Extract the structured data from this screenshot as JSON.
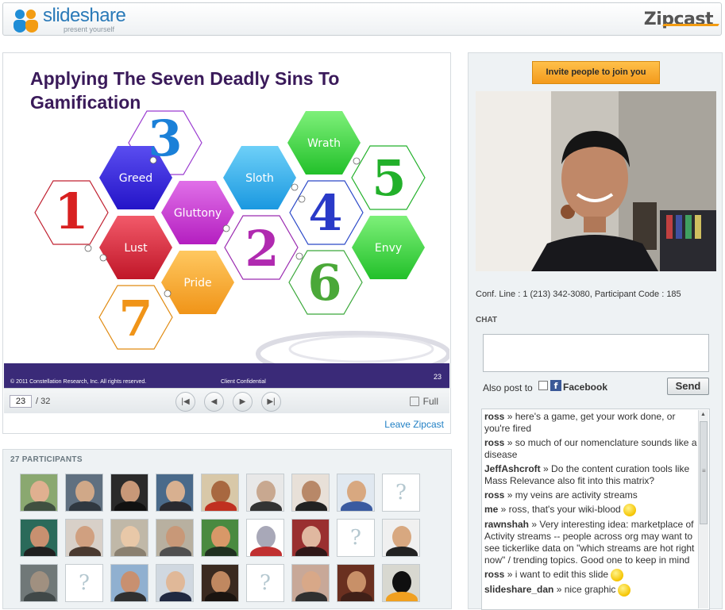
{
  "header": {
    "brand": "slideshare",
    "tagline": "present yourself",
    "product": "Zipcast"
  },
  "slide": {
    "title": "Applying The Seven Deadly Sins To Gamification",
    "sins": [
      "Greed",
      "Gluttony",
      "Sloth",
      "Wrath",
      "Lust",
      "Envy",
      "Pride"
    ],
    "numbers": [
      "1",
      "2",
      "3",
      "4",
      "5",
      "6",
      "7"
    ],
    "footer_left": "© 2011 Constellation Research, Inc.  All rights reserved.",
    "footer_mid": "Client Confidential",
    "footer_page": "23"
  },
  "controls": {
    "current_page": "23",
    "total": "/ 32",
    "full_label": "Full",
    "leave_label": "Leave Zipcast"
  },
  "participants": {
    "title": "27 PARTICIPANTS",
    "unknown_glyph": "?"
  },
  "right": {
    "invite_label": "Invite people to join you",
    "conf_line": "Conf. Line : 1 (213) 342-3080, Participant Code : 185",
    "chat_label": "CHAT",
    "also_post": "Also post to",
    "facebook": "Facebook",
    "send": "Send"
  },
  "chat": [
    {
      "user": "ross",
      "text": " » here's a game, get your work done, or you're fired"
    },
    {
      "user": "ross",
      "text": " » so much of our nomenclature sounds like a disease"
    },
    {
      "user": "JeffAshcroft",
      "text": " » Do the content curation tools like Mass Relevance also fit into this matrix?"
    },
    {
      "user": "ross",
      "text": " » my veins are activity streams"
    },
    {
      "user": "me",
      "text": " » ross, that's your wiki-blood"
    },
    {
      "user": "rawnshah",
      "text": " » Very interesting idea: marketplace of Activity streams -- people across org may want to see tickerlike data on \"which streams are hot right now\" / trending topics. Good one to keep in mind"
    },
    {
      "user": "ross",
      "text": " » i want to edit this slide"
    },
    {
      "user": "slideshare_dan",
      "text": " » nice graphic"
    }
  ]
}
